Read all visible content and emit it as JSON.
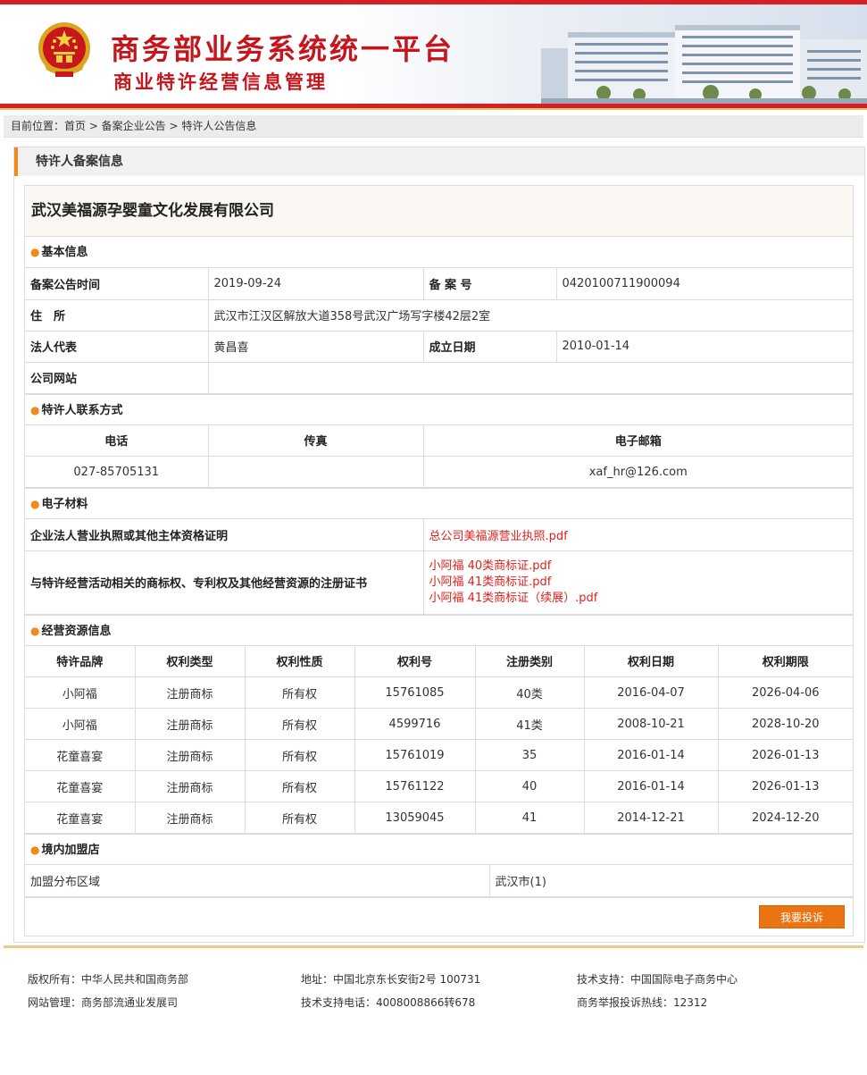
{
  "header": {
    "title": "商务部业务系统统一平台",
    "subtitle": "商业特许经营信息管理",
    "brand_color": "#c4161c"
  },
  "breadcrumb": {
    "text": "目前位置：首页 > 备案企业公告 > 特许人公告信息"
  },
  "panel": {
    "title": "特许人备案信息",
    "company_name": "武汉美福源孕婴童文化发展有限公司",
    "accent_color": "#f08a1d"
  },
  "basic": {
    "section_title": "基本信息",
    "announce_date_label": "备案公告时间",
    "announce_date": "2019-09-24",
    "record_no_label": "备 案 号",
    "record_no": "0420100711900094",
    "address_label": "住　所",
    "address": "武汉市江汉区解放大道358号武汉广场写字楼42层2室",
    "legal_rep_label": "法人代表",
    "legal_rep": "黄昌喜",
    "found_date_label": "成立日期",
    "found_date": "2010-01-14",
    "website_label": "公司网站",
    "website": ""
  },
  "contact": {
    "section_title": "特许人联系方式",
    "phone_label": "电话",
    "fax_label": "传真",
    "email_label": "电子邮箱",
    "phone": "027-85705131",
    "fax": "",
    "email": "xaf_hr@126.com"
  },
  "materials": {
    "section_title": "电子材料",
    "license_label": "企业法人营业执照或其他主体资格证明",
    "license_files": [
      "总公司美福源营业执照.pdf"
    ],
    "trademark_label": "与特许经营活动相关的商标权、专利权及其他经营资源的注册证书",
    "trademark_files": [
      "小阿福 40类商标证.pdf",
      "小阿福 41类商标证.pdf",
      "小阿福 41类商标证（续展）.pdf"
    ]
  },
  "resources": {
    "section_title": "经营资源信息",
    "headers": [
      "特许品牌",
      "权利类型",
      "权利性质",
      "权利号",
      "注册类别",
      "权利日期",
      "权利期限"
    ],
    "rows": [
      [
        "小阿福",
        "注册商标",
        "所有权",
        "15761085",
        "40类",
        "2016-04-07",
        "2026-04-06"
      ],
      [
        "小阿福",
        "注册商标",
        "所有权",
        "4599716",
        "41类",
        "2008-10-21",
        "2028-10-20"
      ],
      [
        "花童喜宴",
        "注册商标",
        "所有权",
        "15761019",
        "35",
        "2016-01-14",
        "2026-01-13"
      ],
      [
        "花童喜宴",
        "注册商标",
        "所有权",
        "15761122",
        "40",
        "2016-01-14",
        "2026-01-13"
      ],
      [
        "花童喜宴",
        "注册商标",
        "所有权",
        "13059045",
        "41",
        "2014-12-21",
        "2024-12-20"
      ]
    ]
  },
  "stores": {
    "section_title": "境内加盟店",
    "region_label": "加盟分布区域",
    "region_value": "武汉市(1)"
  },
  "actions": {
    "complaint_label": "我要投诉",
    "button_color": "#ec7312"
  },
  "footer": {
    "copyright": "版权所有：中华人民共和国商务部",
    "site_admin": "网站管理：商务部流通业发展司",
    "address": "地址：中国北京东长安街2号 100731",
    "support_phone": "技术支持电话：4008008866转678",
    "tech_support": "技术支持：中国国际电子商务中心",
    "hotline": "商务举报投诉热线：12312"
  }
}
